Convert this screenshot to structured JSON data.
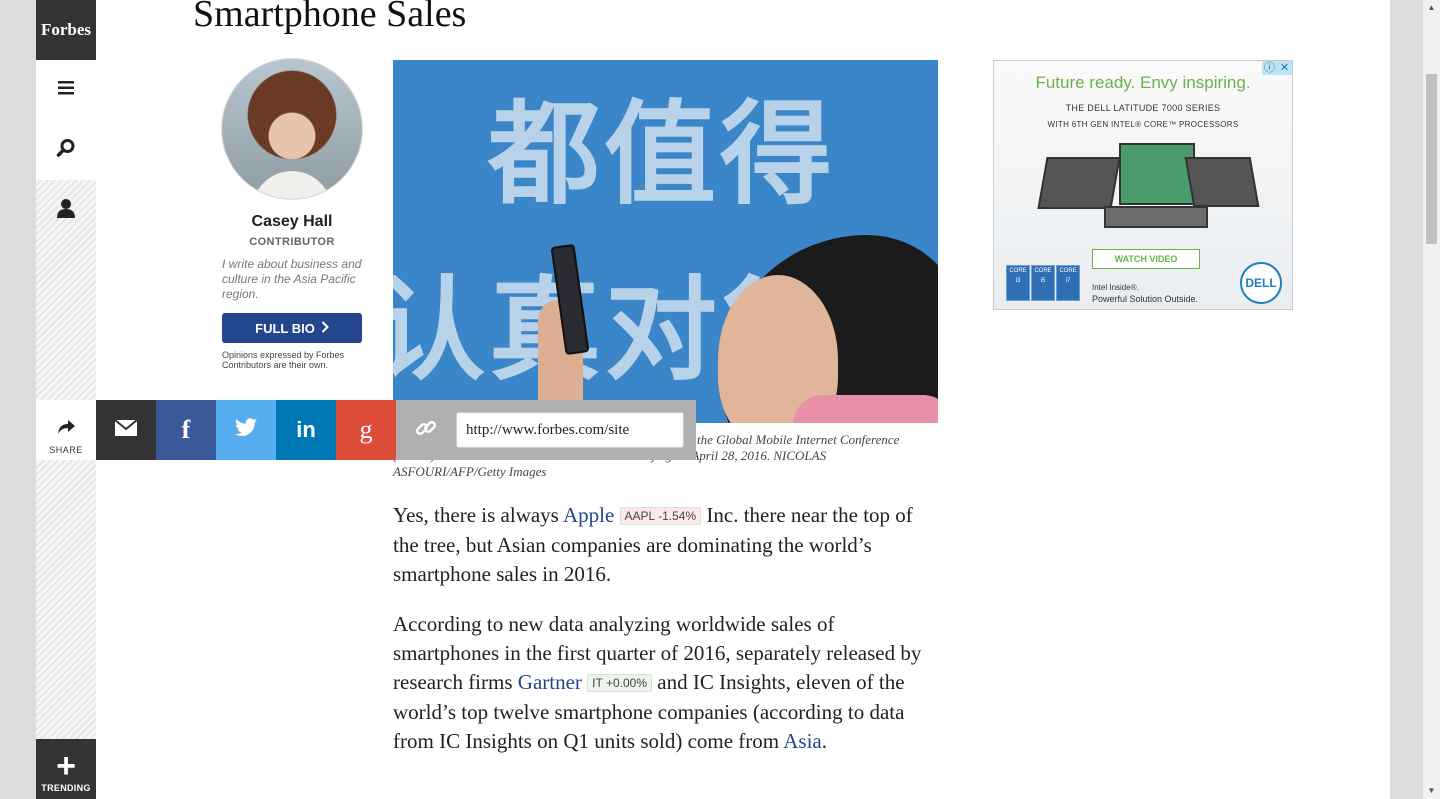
{
  "brand": {
    "logo_text": "Forbes"
  },
  "nav": {
    "share_label": "SHARE",
    "trending_label": "TRENDING"
  },
  "article": {
    "title": "Smartphone Sales",
    "caption_line1": "the Global Mobile Internet Conference",
    "caption_line2": "(GMIC) at the National Convention Center in Beijing on April 28, 2016. NICOLAS",
    "caption_line3": "ASFOURI/AFP/Getty Images",
    "hero_text": [
      "都值得",
      "认真对待"
    ],
    "p1": {
      "before": "Yes, there is always ",
      "link": "Apple",
      "ticker": "AAPL -1.54%",
      "after": " Inc. there near the top of the tree, but Asian companies are dominating the world’s smartphone sales in 2016."
    },
    "p2": {
      "before": "According to new data analyzing worldwide sales of smartphones in the first quarter of 2016, separately released by research firms ",
      "link": "Gartner",
      "ticker": "IT +0.00%",
      "middle": " and IC Insights, eleven of the world’s top twelve smartphone companies (according to data from IC Insights on Q1 units sold) come from ",
      "link2": "Asia",
      "after": "."
    }
  },
  "author": {
    "name": "Casey Hall",
    "role": "CONTRIBUTOR",
    "bio": "I write about business and culture in the Asia Pacific region.",
    "full_bio_label": "FULL BIO",
    "disclaimer": "Opinions expressed by Forbes Contributors are their own."
  },
  "share": {
    "url_value": "http://www.forbes.com/site",
    "icons": [
      "email-icon",
      "facebook-icon",
      "twitter-icon",
      "linkedin-icon",
      "google-plus-icon",
      "link-icon"
    ]
  },
  "ad": {
    "headline": "Future ready. Envy inspiring.",
    "line1": "THE DELL LATITUDE 7000 SERIES",
    "line2": "WITH 6TH GEN INTEL® CORE™ PROCESSORS",
    "cta": "WATCH VIDEO",
    "intel_line1": "Intel Inside®.",
    "intel_line2": "Powerful Solution Outside.",
    "logo_text": "DELL",
    "badges": [
      "CORE i3",
      "CORE i5",
      "CORE i7"
    ]
  },
  "colors": {
    "email": "#333333",
    "facebook": "#3b5998",
    "twitter": "#55acee",
    "linkedin": "#0077b5",
    "google": "#dd4b39",
    "link": "#b0b0b0",
    "brand_blue": "#23468d"
  }
}
